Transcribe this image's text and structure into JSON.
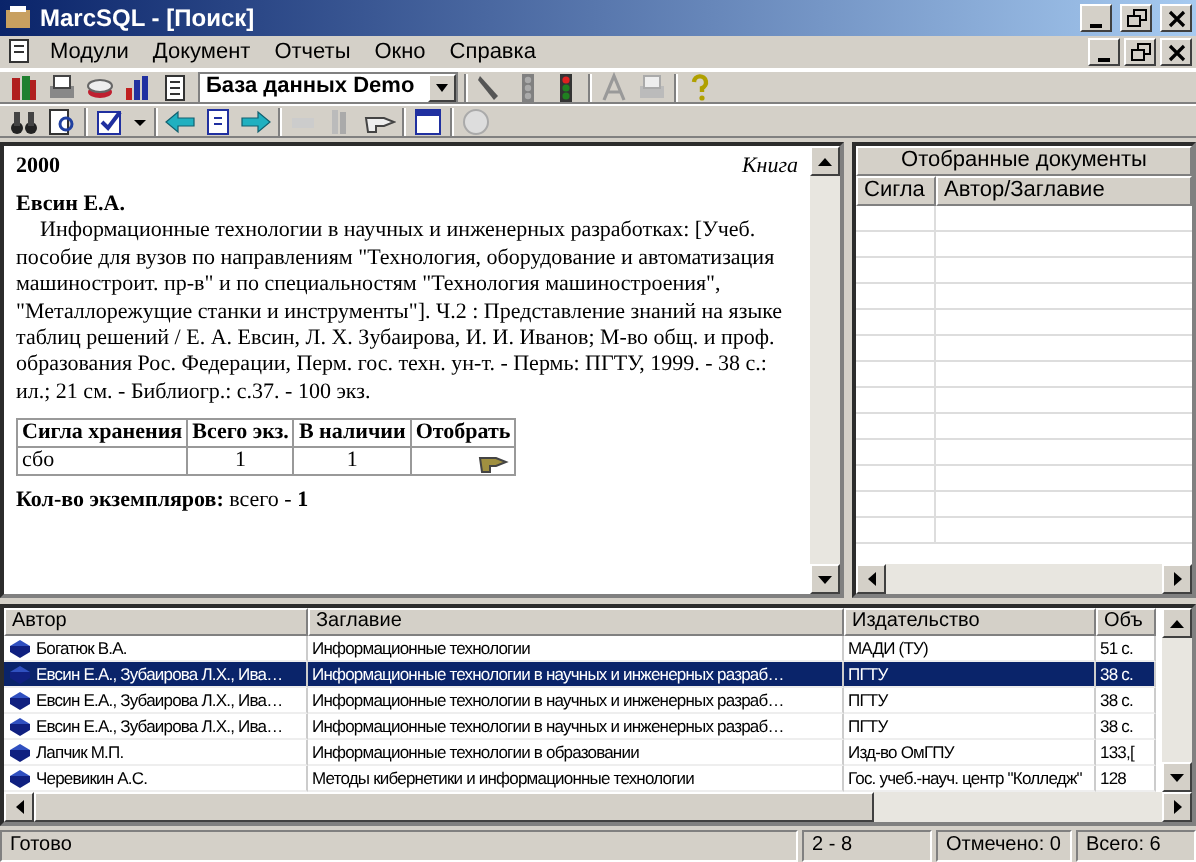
{
  "window": {
    "title": "MarcSQL - [Поиск]"
  },
  "menu": [
    "Модули",
    "Документ",
    "Отчеты",
    "Окно",
    "Справка"
  ],
  "database_combo": {
    "value": "База данных Demo"
  },
  "record": {
    "year": "2000",
    "type": "Книга",
    "author": "Евсин Е.А.",
    "description": "Информационные технологии в научных и инженерных разработках: [Учеб. пособие для вузов по направлениям \"Технология, оборудование и автоматизация машиностроит. пр-в\" и по специальностям \"Технология машиностроения\", \"Металлорежущие станки и инструменты\"]. Ч.2 : Представление знаний на языке таблиц решений / Е. А. Евсин, Л. Х. Зубаирова, И. И. Иванов; М-во общ. и проф. образования Рос. Федерации, Перм. гос. техн. ун-т. - Пермь: ПГТУ, 1999. - 38 с.: ил.; 21 см. - Библиогр.: с.37. - 100 экз.",
    "holdings": {
      "columns": [
        "Сигла хранения",
        "Всего экз.",
        "В наличии",
        "Отобрать"
      ],
      "rows": [
        {
          "siglum": "сбо",
          "total": "1",
          "available": "1"
        }
      ]
    },
    "summary": "**Кол-во экземпляров:** всего - **1**"
  },
  "selected_documents": {
    "title": "Отобранные документы",
    "columns": [
      "Сигла",
      "Автор/Заглавие"
    ]
  },
  "results": {
    "columns": [
      "Автор",
      "Заглавие",
      "Издательство",
      "Объ"
    ],
    "rows": [
      {
        "cells": [
          "Богатюк В.А.",
          "Информационные технологии",
          "МАДИ (ТУ)",
          "51 с."
        ],
        "selected": false
      },
      {
        "cells": [
          "Евсин Е.А., Зубаирова Л.Х., Ива…",
          "Информационные технологии в научных и инженерных разраб…",
          "ПГТУ",
          "38 с."
        ],
        "selected": true
      },
      {
        "cells": [
          "Евсин Е.А., Зубаирова Л.Х., Ива…",
          "Информационные технологии в научных и инженерных разраб…",
          "ПГТУ",
          "38 с."
        ],
        "selected": false
      },
      {
        "cells": [
          "Евсин Е.А., Зубаирова Л.Х., Ива…",
          "Информационные технологии в научных и инженерных разраб…",
          "ПГТУ",
          "38 с."
        ],
        "selected": false
      },
      {
        "cells": [
          "Лапчик М.П.",
          "Информационные технологии в образовании",
          "Изд-во ОмГПУ",
          "133,["
        ],
        "selected": false
      },
      {
        "cells": [
          "Черевикин А.С.",
          "Методы кибернетики и информационные технологии",
          "Гос. учеб.-науч. центр \"Колледж\"",
          "128"
        ],
        "selected": false
      }
    ]
  },
  "status_bar": [
    "Готово",
    "2 - 8",
    "Отмечено: 0",
    "Всего: 6"
  ]
}
